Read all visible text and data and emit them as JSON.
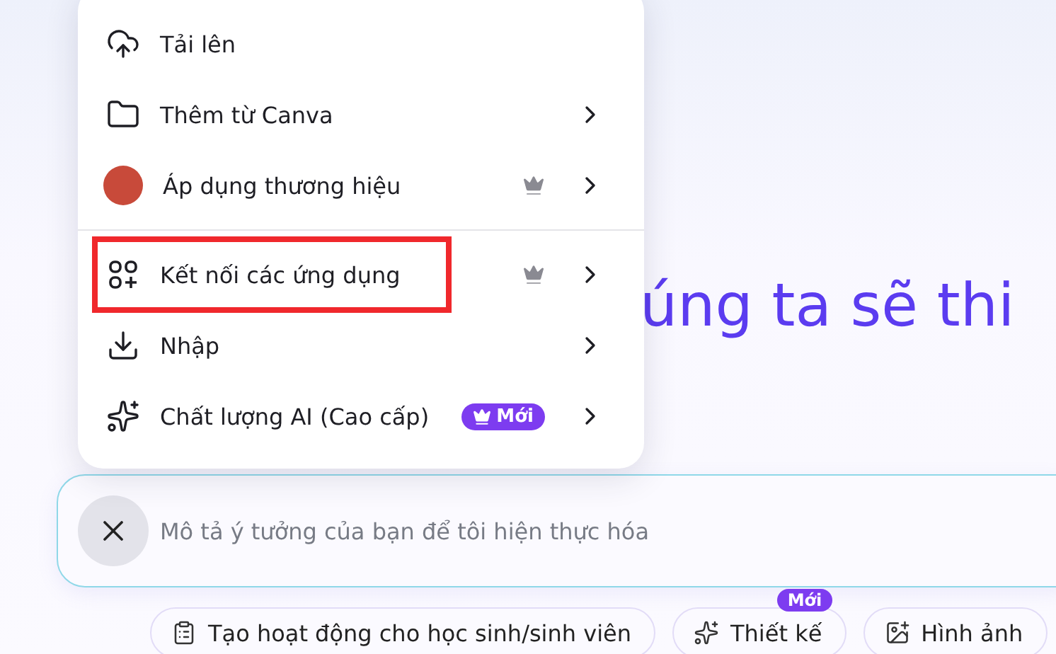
{
  "menu": {
    "groups": [
      [
        {
          "kind": "upload",
          "label": "Tải lên",
          "premium": false,
          "submenu": false,
          "highlighted": false
        },
        {
          "kind": "folder",
          "label": "Thêm từ Canva",
          "premium": false,
          "submenu": true,
          "highlighted": false
        },
        {
          "kind": "avatar",
          "label": "Áp dụng thương hiệu",
          "premium": true,
          "submenu": true,
          "highlighted": false
        }
      ],
      [
        {
          "kind": "apps",
          "label": "Kết nối các ứng dụng",
          "premium": true,
          "submenu": true,
          "highlighted": true
        },
        {
          "kind": "import",
          "label": "Nhập",
          "premium": false,
          "submenu": true,
          "highlighted": false
        },
        {
          "kind": "sparkles",
          "label": "Chất lượng AI (Cao cấp)",
          "premium": false,
          "badge": "Mới",
          "submenu": true,
          "highlighted": false
        }
      ]
    ]
  },
  "headline": "úng ta sẽ thi",
  "prompt": {
    "placeholder": "Mô tả ý tưởng của bạn để tôi hiện thực hóa"
  },
  "chips": [
    {
      "kind": "activity",
      "label": "Tạo hoạt động cho học sinh/sinh viên"
    },
    {
      "kind": "sparkles",
      "label": "Thiết kế",
      "badge": "Mới"
    },
    {
      "kind": "image",
      "label": "Hình ảnh"
    }
  ]
}
